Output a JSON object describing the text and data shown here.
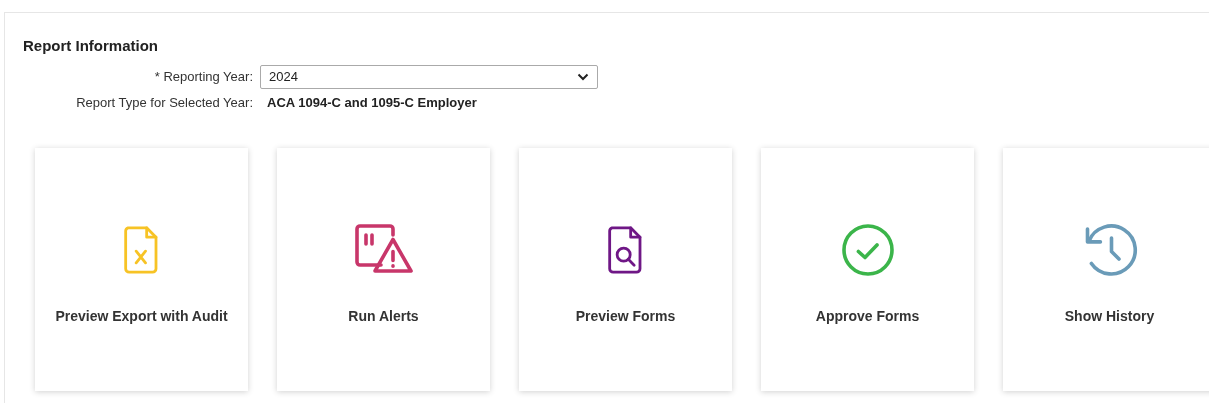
{
  "section": {
    "title": "Report Information"
  },
  "fields": [
    {
      "kind": "select",
      "required_mark": "*",
      "label": "Reporting Year:",
      "value": "2024"
    },
    {
      "kind": "text",
      "label": "Report Type for Selected Year:",
      "value": "ACA 1094-C and 1095-C Employer"
    }
  ],
  "actions": [
    {
      "kind": "export",
      "label": "Preview Export with Audit"
    },
    {
      "kind": "alerts",
      "label": "Run Alerts"
    },
    {
      "kind": "preview",
      "label": "Preview Forms"
    },
    {
      "kind": "approve",
      "label": "Approve Forms"
    },
    {
      "kind": "history",
      "label": "Show History"
    }
  ]
}
